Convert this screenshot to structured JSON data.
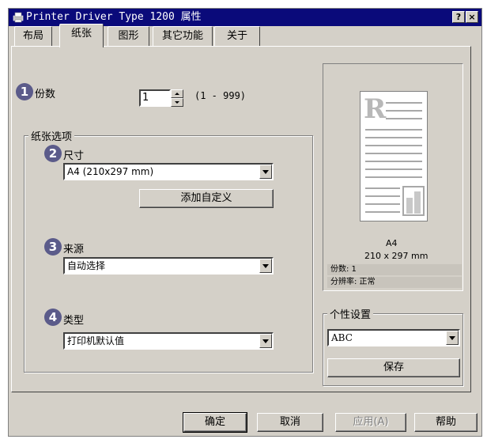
{
  "window": {
    "title": "Printer Driver Type 1200 属性",
    "help_glyph": "?",
    "close_glyph": "×"
  },
  "tabs": [
    {
      "label": "布局"
    },
    {
      "label": "纸张"
    },
    {
      "label": "图形"
    },
    {
      "label": "其它功能"
    },
    {
      "label": "关于"
    }
  ],
  "copies": {
    "badge": "1",
    "label": "份数",
    "value": "1",
    "range": "(1 - 999)"
  },
  "paper_group": {
    "title": "纸张选项",
    "size": {
      "badge": "2",
      "label": "尺寸",
      "selected": "A4 (210x297 mm)",
      "custom_button": "添加自定义"
    },
    "source": {
      "badge": "3",
      "label": "来源",
      "selected": "自动选择"
    },
    "type": {
      "badge": "4",
      "label": "类型",
      "selected": "打印机默认值"
    }
  },
  "preview": {
    "page_letter": "R",
    "size_name": "A4",
    "size_dims": "210 x 297 mm",
    "copies_line": "份数: 1",
    "resolution_line": "分辨率: 正常"
  },
  "profile_group": {
    "title": "个性设置",
    "selected": "ABC",
    "save_button": "保存"
  },
  "footer": {
    "ok": "确定",
    "cancel": "取消",
    "apply": "应用(A)",
    "help": "帮助"
  },
  "colors": {
    "titlebar": "#0a0a7a",
    "dialog_face": "#d4d0c8",
    "badge": "#5b5b8a"
  }
}
